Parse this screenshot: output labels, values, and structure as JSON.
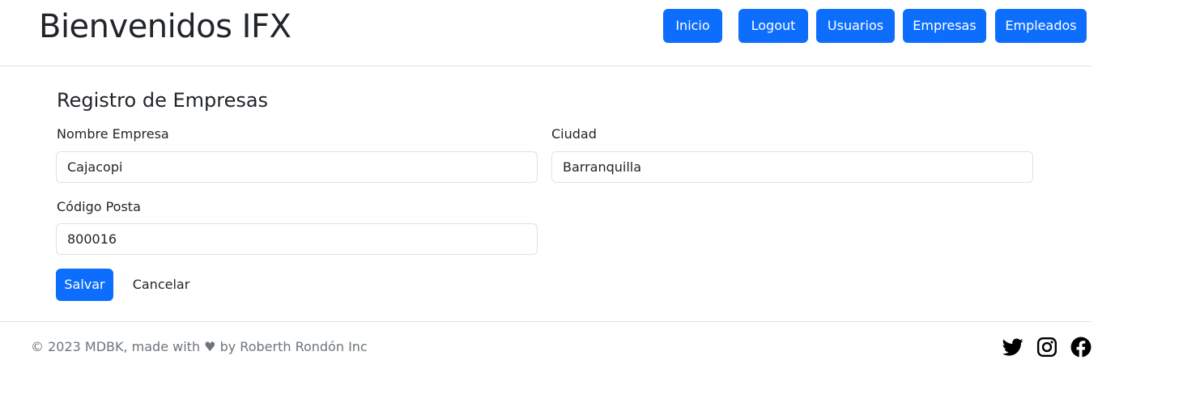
{
  "header": {
    "brand": "Bienvenidos IFX",
    "nav": [
      {
        "label": "Inicio"
      },
      {
        "label": "Logout"
      },
      {
        "label": "Usuarios"
      },
      {
        "label": "Empresas"
      },
      {
        "label": "Empleados"
      }
    ]
  },
  "form": {
    "title": "Registro de Empresas",
    "fields": {
      "nombre": {
        "label": "Nombre Empresa",
        "value": "Cajacopi"
      },
      "ciudad": {
        "label": "Ciudad",
        "value": "Barranquilla"
      },
      "codigo": {
        "label": "Código Posta",
        "value": "800016"
      }
    },
    "save_label": "Salvar",
    "cancel_label": "Cancelar"
  },
  "footer": {
    "copyright": "© 2023 MDBK, made with ♥ by Roberth Rondón Inc",
    "social": [
      "twitter-icon",
      "instagram-icon",
      "facebook-icon"
    ]
  },
  "colors": {
    "primary": "#0d6efd",
    "border": "#dee2e6",
    "muted_text": "#6c757d"
  }
}
